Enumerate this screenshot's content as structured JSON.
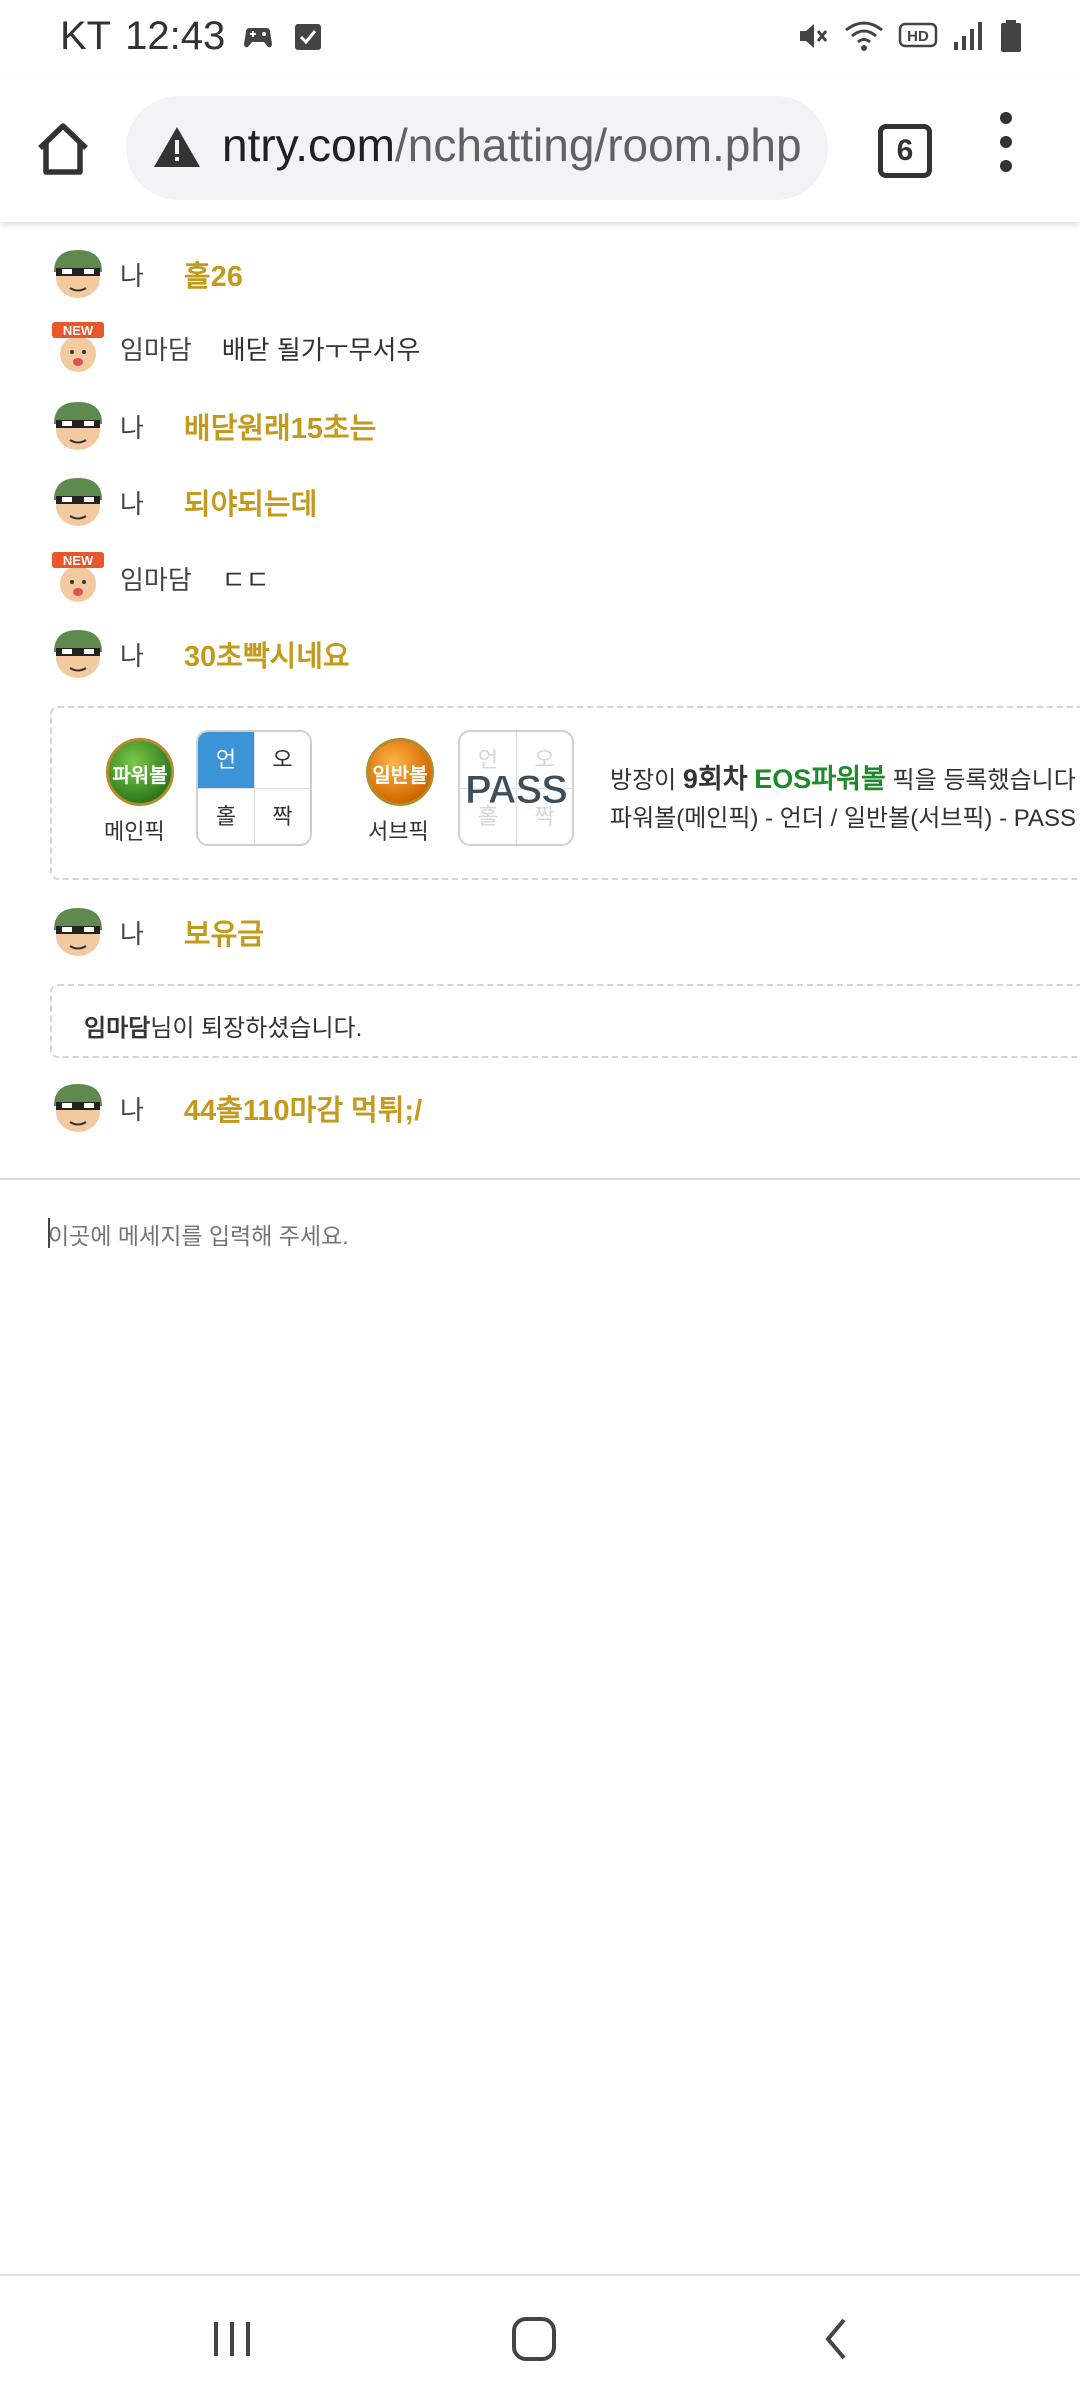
{
  "status_bar": {
    "carrier": "KT",
    "time": "12:43",
    "left_icons": [
      "game-icon",
      "checkbox-icon"
    ],
    "right_icons": [
      "mute-icon",
      "wifi-icon",
      "hd-voice-icon",
      "signal-icon",
      "battery-icon"
    ],
    "hd_label": "HD"
  },
  "browser": {
    "url_domain": "ntry.com",
    "url_path": "/nchatting/room.php",
    "tab_count": "6",
    "icons": [
      "home-icon",
      "warning-icon",
      "tabs-icon",
      "more-icon"
    ]
  },
  "chat": {
    "messages": [
      {
        "nick": "나",
        "text": "홀26",
        "mine": true
      },
      {
        "nick": "임마담",
        "text": "배닫 될가ㅜ무서우",
        "mine": false
      },
      {
        "nick": "나",
        "text": "배닫원래15초는",
        "mine": true
      },
      {
        "nick": "나",
        "text": "되야되는데",
        "mine": true
      },
      {
        "nick": "임마담",
        "text": "ㄷㄷ",
        "mine": false
      },
      {
        "nick": "나",
        "text": "30초빡시네요",
        "mine": true
      },
      {
        "nick": "나",
        "text": "보유금",
        "mine": true
      },
      {
        "nick": "나",
        "text": "44출110마감 먹튀;/",
        "mine": true
      }
    ],
    "new_badge": "NEW",
    "pick": {
      "main_ball": "파워볼",
      "main_label": "메인픽",
      "main_grid": [
        "언",
        "오",
        "홀",
        "짝"
      ],
      "main_selected": "언",
      "sub_ball": "일반볼",
      "sub_label": "서브픽",
      "sub_grid": [
        "언",
        "오",
        "홀",
        "짝"
      ],
      "sub_badge": "PASS",
      "desc_prefix": "방장이 ",
      "desc_round": "9회차",
      "desc_game": "EOS파워볼",
      "desc_suffix": " 픽을 등록했습니다",
      "desc_line2": "파워볼(메인픽) - 언더 / 일반볼(서브픽) - PASS"
    },
    "exit_notice": {
      "name": "임마담",
      "text": "님이 퇴장하셨습니다."
    }
  },
  "input": {
    "placeholder": "이곳에 메세지를 입력해 주세요."
  },
  "nav_bar": {
    "icons": [
      "recent-apps-icon",
      "home-nav-icon",
      "back-icon"
    ]
  },
  "colors": {
    "mine_text": "#c49a1c",
    "selected_cell": "#3b94d8",
    "game_name": "#1e8a2c"
  }
}
